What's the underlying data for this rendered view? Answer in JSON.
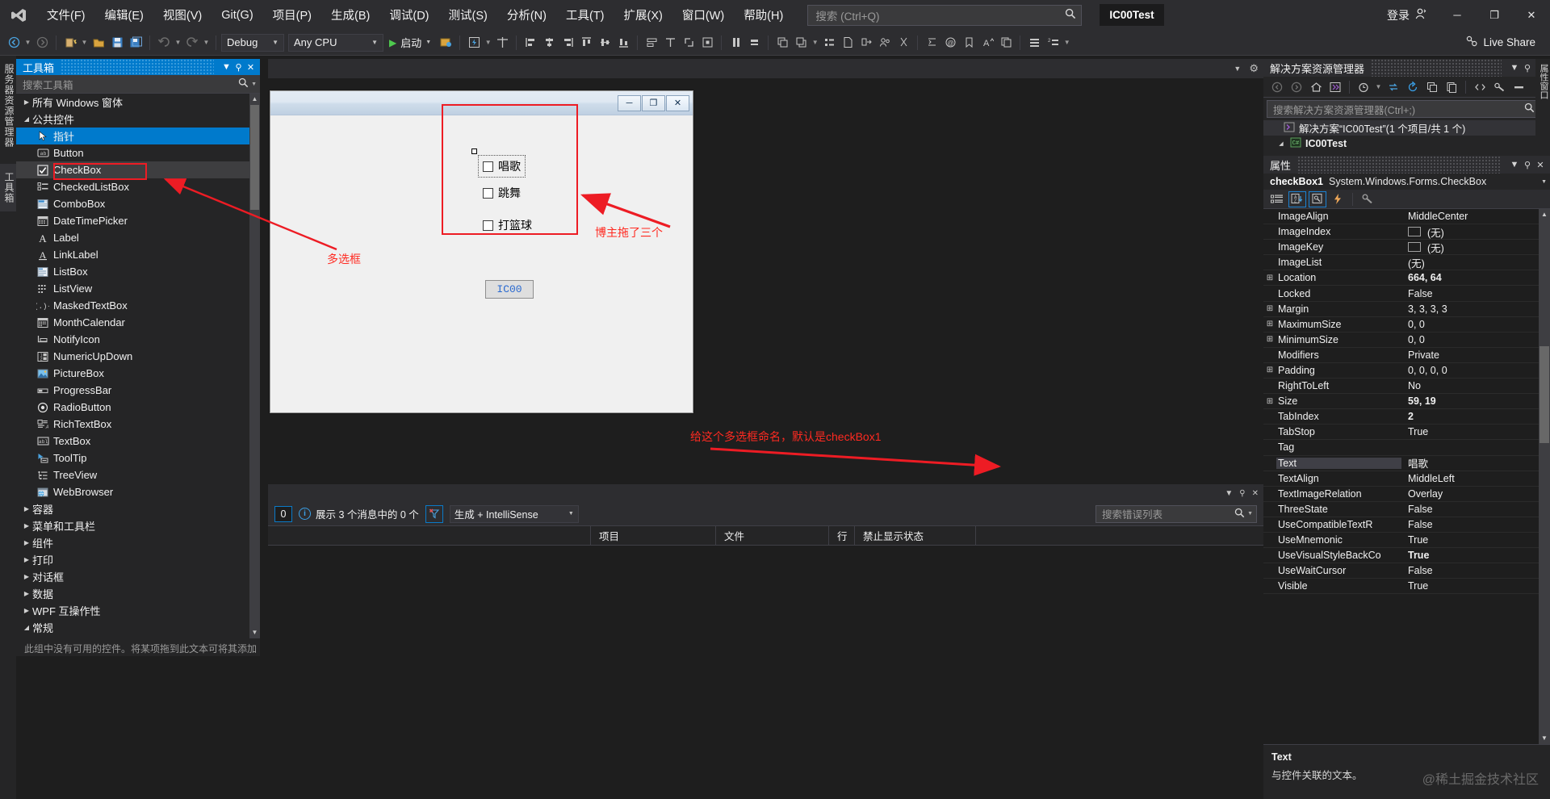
{
  "titlebar": {
    "menus": [
      "文件(F)",
      "编辑(E)",
      "视图(V)",
      "Git(G)",
      "项目(P)",
      "生成(B)",
      "调试(D)",
      "测试(S)",
      "分析(N)",
      "工具(T)",
      "扩展(X)",
      "窗口(W)",
      "帮助(H)"
    ],
    "search_placeholder": "搜索 (Ctrl+Q)",
    "project_chip": "IC00Test",
    "signin": "登录",
    "minimize": "─",
    "maximize": "❐",
    "close": "✕"
  },
  "toolbar": {
    "configuration": "Debug",
    "platform": "Any CPU",
    "run_label": "启动",
    "live_share": "Live Share"
  },
  "vtabs": {
    "server_explorer": "服务器资源管理器",
    "toolbox": "工具箱"
  },
  "toolbox": {
    "title": "工具箱",
    "search_placeholder": "搜索工具箱",
    "groups": [
      {
        "label": "所有 Windows 窗体",
        "expanded": false
      },
      {
        "label": "公共控件",
        "expanded": true
      }
    ],
    "items": [
      {
        "label": "指针",
        "icon": "pointer-icon",
        "selected": true
      },
      {
        "label": "Button",
        "icon": "button-icon"
      },
      {
        "label": "CheckBox",
        "icon": "checkbox-icon",
        "highlighted": true
      },
      {
        "label": "CheckedListBox",
        "icon": "checkedlistbox-icon"
      },
      {
        "label": "ComboBox",
        "icon": "combobox-icon"
      },
      {
        "label": "DateTimePicker",
        "icon": "datetimepicker-icon"
      },
      {
        "label": "Label",
        "icon": "label-icon"
      },
      {
        "label": "LinkLabel",
        "icon": "linklabel-icon"
      },
      {
        "label": "ListBox",
        "icon": "listbox-icon"
      },
      {
        "label": "ListView",
        "icon": "listview-icon"
      },
      {
        "label": "MaskedTextBox",
        "icon": "maskedtextbox-icon"
      },
      {
        "label": "MonthCalendar",
        "icon": "monthcalendar-icon"
      },
      {
        "label": "NotifyIcon",
        "icon": "notifyicon-icon"
      },
      {
        "label": "NumericUpDown",
        "icon": "numericupdown-icon"
      },
      {
        "label": "PictureBox",
        "icon": "picturebox-icon"
      },
      {
        "label": "ProgressBar",
        "icon": "progressbar-icon"
      },
      {
        "label": "RadioButton",
        "icon": "radiobutton-icon"
      },
      {
        "label": "RichTextBox",
        "icon": "richtextbox-icon"
      },
      {
        "label": "TextBox",
        "icon": "textbox-icon"
      },
      {
        "label": "ToolTip",
        "icon": "tooltip-icon"
      },
      {
        "label": "TreeView",
        "icon": "treeview-icon"
      },
      {
        "label": "WebBrowser",
        "icon": "webbrowser-icon"
      }
    ],
    "trailing_groups": [
      "容器",
      "菜单和工具栏",
      "组件",
      "打印",
      "对话框",
      "数据",
      "WPF 互操作性"
    ],
    "last_group": {
      "label": "常规",
      "expanded": true
    },
    "footer_note": "此组中没有可用的控件。将某项拖到此文本可将其添加"
  },
  "designer": {
    "form": {
      "minimize": "─",
      "maximize": "❐",
      "close": "✕",
      "checkboxes": [
        {
          "label": "唱歌",
          "checked": false,
          "selected": true
        },
        {
          "label": "跳舞",
          "checked": false,
          "selected": false
        },
        {
          "label": "打篮球",
          "checked": false,
          "selected": false
        }
      ],
      "button_label": "IC00"
    },
    "annotations": [
      {
        "name": "checkbox-label-annotation",
        "text": "多选框"
      },
      {
        "name": "dragged-three-annotation",
        "text": "博主拖了三个"
      },
      {
        "name": "name-checkbox-annotation",
        "text": "给这个多选框命名，默认是checkBox1"
      }
    ]
  },
  "errorlist": {
    "count": "0",
    "message": "展示 3 个消息中的 0 个",
    "scope": "生成 + IntelliSense",
    "search_placeholder": "搜索错误列表",
    "columns": [
      "",
      "项目",
      "文件",
      "行",
      "禁止显示状态"
    ],
    "rows": []
  },
  "solution_explorer": {
    "title": "解决方案资源管理器",
    "search_placeholder": "搜索解决方案资源管理器(Ctrl+;)",
    "tree": [
      {
        "label": "解决方案“IC00Test”(1 个项目/共 1 个)",
        "icon": "solution-icon",
        "selected": true,
        "indent": 0
      },
      {
        "label": "IC00Test",
        "icon": "csharp-project-icon",
        "selected": false,
        "indent": 1,
        "expanded": true
      }
    ]
  },
  "properties": {
    "title": "属性",
    "object_name": "checkBox1",
    "object_type": "System.Windows.Forms.CheckBox",
    "rows": [
      {
        "name": "ImageAlign",
        "value": "MiddleCenter",
        "expandable": false,
        "bold": false
      },
      {
        "name": "ImageIndex",
        "value": "(无)",
        "expandable": false,
        "bold": false,
        "swatch": true
      },
      {
        "name": "ImageKey",
        "value": "(无)",
        "expandable": false,
        "bold": false,
        "swatch": true
      },
      {
        "name": "ImageList",
        "value": "(无)",
        "expandable": false,
        "bold": false
      },
      {
        "name": "Location",
        "value": "664, 64",
        "expandable": true,
        "bold": true
      },
      {
        "name": "Locked",
        "value": "False",
        "expandable": false,
        "bold": false
      },
      {
        "name": "Margin",
        "value": "3, 3, 3, 3",
        "expandable": true,
        "bold": false
      },
      {
        "name": "MaximumSize",
        "value": "0, 0",
        "expandable": true,
        "bold": false
      },
      {
        "name": "MinimumSize",
        "value": "0, 0",
        "expandable": true,
        "bold": false
      },
      {
        "name": "Modifiers",
        "value": "Private",
        "expandable": false,
        "bold": false
      },
      {
        "name": "Padding",
        "value": "0, 0, 0, 0",
        "expandable": true,
        "bold": false
      },
      {
        "name": "RightToLeft",
        "value": "No",
        "expandable": false,
        "bold": false
      },
      {
        "name": "Size",
        "value": "59, 19",
        "expandable": true,
        "bold": true
      },
      {
        "name": "TabIndex",
        "value": "2",
        "expandable": false,
        "bold": true
      },
      {
        "name": "TabStop",
        "value": "True",
        "expandable": false,
        "bold": false
      },
      {
        "name": "Tag",
        "value": "",
        "expandable": false,
        "bold": false
      },
      {
        "name": "Text",
        "value": "唱歌",
        "expandable": false,
        "bold": false,
        "selected": true
      },
      {
        "name": "TextAlign",
        "value": "MiddleLeft",
        "expandable": false,
        "bold": false
      },
      {
        "name": "TextImageRelation",
        "value": "Overlay",
        "expandable": false,
        "bold": false
      },
      {
        "name": "ThreeState",
        "value": "False",
        "expandable": false,
        "bold": false
      },
      {
        "name": "UseCompatibleTextR",
        "value": "False",
        "expandable": false,
        "bold": false
      },
      {
        "name": "UseMnemonic",
        "value": "True",
        "expandable": false,
        "bold": false
      },
      {
        "name": "UseVisualStyleBackCo",
        "value": "True",
        "expandable": false,
        "bold": true
      },
      {
        "name": "UseWaitCursor",
        "value": "False",
        "expandable": false,
        "bold": false
      },
      {
        "name": "Visible",
        "value": "True",
        "expandable": false,
        "bold": false
      }
    ],
    "description_title": "Text",
    "description_text": "与控件关联的文本。"
  },
  "watermark": "@稀土掘金技术社区"
}
